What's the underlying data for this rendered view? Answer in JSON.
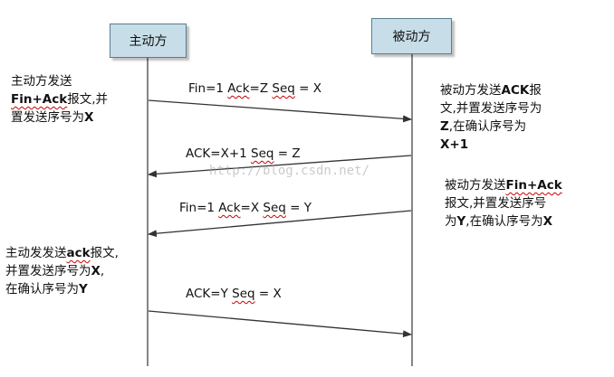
{
  "top_title": "",
  "actors": {
    "active": "主动方",
    "passive": "被动方"
  },
  "notes": {
    "active_1": {
      "line1": "主动方发送",
      "line2_bold": "Fin+Ack",
      "line2_rest": "报文,并",
      "line3_text": "置发送序号为",
      "line3_bold": "X"
    },
    "passive_1": {
      "line1_text": "被动方发送",
      "line1_bold": "ACK",
      "line1_rest": "报",
      "line2": "文,并置发送序号为",
      "line3_bold": "Z",
      "line3_rest": ",在确认序号为",
      "line4_bold": "X+1"
    },
    "passive_2": {
      "line1_text": "被动方发送",
      "line1_bold": "Fin+Ack",
      "line2": "报文,并置发送序号",
      "line3_text": "为",
      "line3_bold": "Y",
      "line3_rest": ",在确认序号为",
      "line3_end_bold": "X"
    },
    "active_2": {
      "line1_text": "主动发发送",
      "line1_bold": "ack",
      "line1_rest": "报文,",
      "line2_text": "并置发送序号为",
      "line2_bold": "X",
      "line2_end": ",",
      "line3_text": "在确认序号为",
      "line3_bold": "Y"
    }
  },
  "messages": [
    {
      "a": "Fin=1 ",
      "b": "Ack",
      "c": "=Z ",
      "d": "Seq",
      "e": " = X"
    },
    {
      "a": "ACK=X+1 ",
      "b": "Seq",
      "c": " = Z"
    },
    {
      "a": "Fin=1 ",
      "b": "Ack",
      "c": "=X ",
      "d": "Seq",
      "e": " = Y"
    },
    {
      "a": "ACK=Y ",
      "b": "Seq",
      "c": " = X"
    }
  ],
  "watermark": "http://blog.csdn.net/",
  "colors": {
    "actor_fill": "#c7dde8",
    "line": "#444444",
    "watermark": "#a0a0a0"
  }
}
